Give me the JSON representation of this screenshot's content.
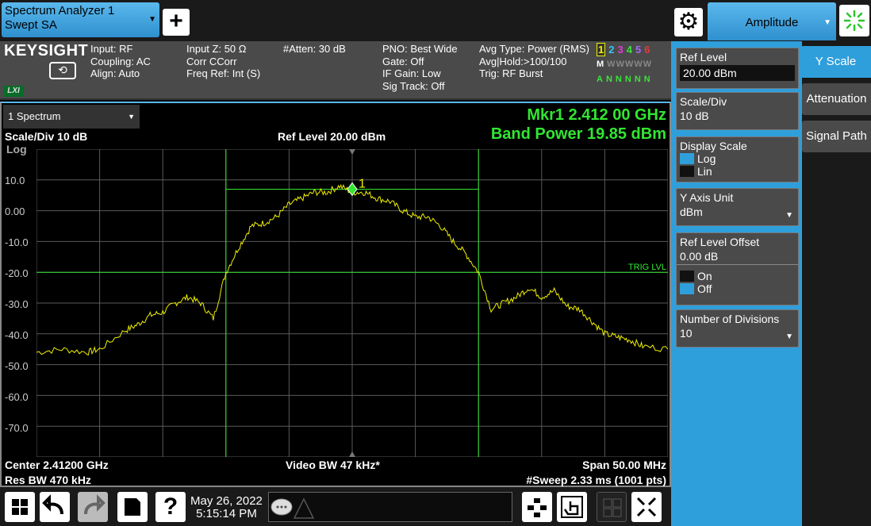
{
  "title_bar": {
    "analyzer_line1": "Spectrum Analyzer 1",
    "analyzer_line2": "Swept SA",
    "menu_title": "Amplitude"
  },
  "info_bar": {
    "brand": "KEYSIGHT",
    "lxi": "LXI",
    "col1": [
      "Input: RF",
      "Coupling: AC",
      "Align: Auto"
    ],
    "col2": [
      "Input Z: 50 Ω",
      "Corr CCorr",
      "Freq Ref: Int (S)"
    ],
    "col3": [
      "#Atten: 30 dB"
    ],
    "col4": [
      "PNO: Best Wide",
      "Gate: Off",
      "IF Gain: Low",
      "Sig Track: Off"
    ],
    "col5": [
      "Avg Type: Power (RMS)",
      "Avg|Hold:>100/100",
      "Trig: RF Burst"
    ],
    "trace_numbers": [
      "1",
      "2",
      "3",
      "4",
      "5",
      "6"
    ],
    "trace_type_row": [
      "M",
      "W",
      "W",
      "W",
      "W",
      "W"
    ],
    "trace_det_row": [
      "A",
      "N",
      "N",
      "N",
      "N",
      "N"
    ]
  },
  "graph": {
    "window_select": "1 Spectrum",
    "scale_div": "Scale/Div 10 dB",
    "scale_type": "Log",
    "ref_level": "Ref Level 20.00 dBm",
    "marker_freq": "Mkr1  2.412 00 GHz",
    "band_power": "Band Power 19.85 dBm",
    "marker_label": "1",
    "trig_label": "TRIG LVL",
    "y_ticks": [
      "10.0",
      "0.00",
      "-10.0",
      "-20.0",
      "-30.0",
      "-40.0",
      "-50.0",
      "-60.0",
      "-70.0"
    ],
    "center": "Center 2.41200 GHz",
    "res_bw": "Res BW 470 kHz",
    "video_bw": "Video BW 47 kHz*",
    "span": "Span 50.00 MHz",
    "sweep": "#Sweep 2.33 ms (1001 pts)"
  },
  "chart_data": {
    "type": "line",
    "title": "",
    "xlabel": "",
    "ylabel": "",
    "x_range_mhz": [
      2387,
      2437
    ],
    "ylim": [
      -80,
      20
    ],
    "grid": true,
    "trig_level_dbm": -20,
    "band_power_lines_mhz": [
      2402,
      2422
    ],
    "band_power_level_dbm": 7,
    "marker": {
      "x_mhz": 2412,
      "y_dbm": 7
    },
    "series": [
      {
        "x": [
          2387,
          2389,
          2391,
          2392,
          2394,
          2395,
          2396,
          2397,
          2398,
          2399,
          2400,
          2401,
          2402,
          2403,
          2404,
          2405,
          2406,
          2407,
          2408,
          2409,
          2410,
          2411,
          2412,
          2413,
          2414,
          2415,
          2416,
          2417,
          2418,
          2419,
          2420,
          2421,
          2422,
          2423,
          2424,
          2425,
          2426,
          2427,
          2428,
          2429,
          2430,
          2431,
          2432,
          2433,
          2434,
          2435,
          2437
        ],
        "y": [
          -46,
          -45,
          -46,
          -45,
          -39,
          -37,
          -34,
          -33,
          -30,
          -28,
          -30,
          -35,
          -20,
          -12,
          -5,
          -4,
          -2,
          2,
          4,
          6,
          6,
          8,
          6,
          6,
          4,
          3,
          0,
          -2,
          -2,
          -5,
          -10,
          -14,
          -20,
          -32,
          -30,
          -28,
          -25,
          -28,
          -26,
          -31,
          -32,
          -36,
          -40,
          -41,
          -42,
          -44,
          -45
        ]
      }
    ]
  },
  "panel": {
    "ref_level": {
      "title": "Ref Level",
      "value": "20.00 dBm"
    },
    "scale_div": {
      "title": "Scale/Div",
      "value": "10 dB"
    },
    "display_scale": {
      "title": "Display Scale",
      "opt1": "Log",
      "opt2": "Lin"
    },
    "y_axis_unit": {
      "title": "Y Axis Unit",
      "value": "dBm"
    },
    "ref_level_offset": {
      "title": "Ref Level Offset",
      "value": "0.00 dB",
      "opt1": "On",
      "opt2": "Off"
    },
    "num_divisions": {
      "title": "Number of Divisions",
      "value": "10"
    }
  },
  "tabs": [
    "Y Scale",
    "Attenuation",
    "Signal Path"
  ],
  "bottom": {
    "date": "May 26, 2022",
    "time": "5:15:14 PM"
  },
  "colors": {
    "accent": "#2f9fdb",
    "trace": "#f0f000",
    "marker": "#32e632",
    "grid": "#5a5a5a"
  }
}
